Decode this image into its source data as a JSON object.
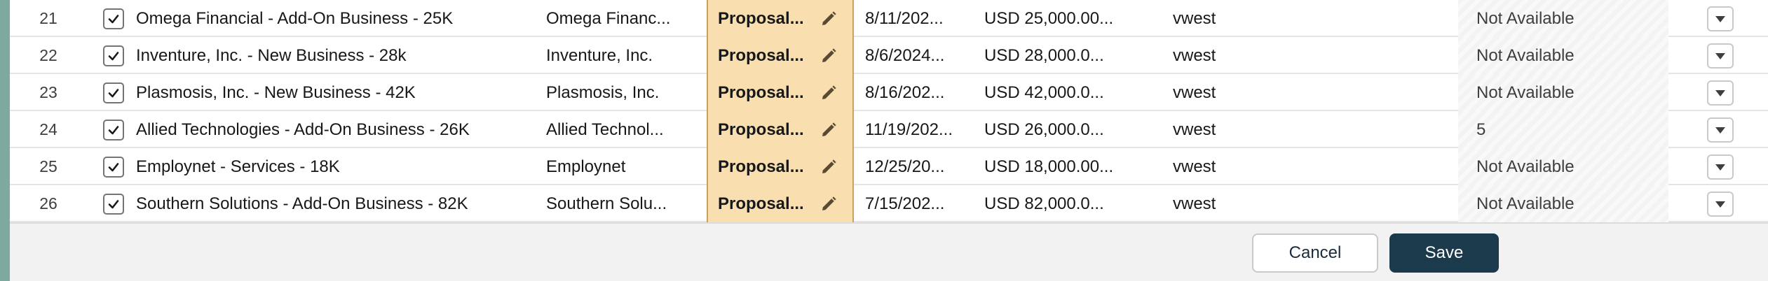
{
  "colors": {
    "stage_bg": "#f9dfb0",
    "save_bg": "#1b3a4b",
    "page_edge": "#7fa8a0"
  },
  "rows": [
    {
      "num": "21",
      "name": "Omega Financial - Add-On Business - 25K",
      "account": "Omega Financ...",
      "stage": "Proposal...",
      "close_date": "8/11/202...",
      "amount": "USD 25,000.00...",
      "owner": "vwest",
      "availability": "Not Available",
      "checked": true
    },
    {
      "num": "22",
      "name": "Inventure, Inc. - New Business - 28k",
      "account": "Inventure, Inc.",
      "stage": "Proposal...",
      "close_date": "8/6/2024...",
      "amount": "USD 28,000.0...",
      "owner": "vwest",
      "availability": "Not Available",
      "checked": true
    },
    {
      "num": "23",
      "name": "Plasmosis, Inc. - New Business - 42K",
      "account": "Plasmosis, Inc.",
      "stage": "Proposal...",
      "close_date": "8/16/202...",
      "amount": "USD 42,000.0...",
      "owner": "vwest",
      "availability": "Not Available",
      "checked": true
    },
    {
      "num": "24",
      "name": "Allied Technologies - Add-On Business - 26K",
      "account": "Allied Technol...",
      "stage": "Proposal...",
      "close_date": "11/19/202...",
      "amount": "USD 26,000.0...",
      "owner": "vwest",
      "availability": "5",
      "checked": true
    },
    {
      "num": "25",
      "name": "Employnet - Services - 18K",
      "account": "Employnet",
      "stage": "Proposal...",
      "close_date": "12/25/20...",
      "amount": "USD 18,000.00...",
      "owner": "vwest",
      "availability": "Not Available",
      "checked": true
    },
    {
      "num": "26",
      "name": "Southern Solutions - Add-On Business - 82K",
      "account": "Southern Solu...",
      "stage": "Proposal...",
      "close_date": "7/15/202...",
      "amount": "USD 82,000.0...",
      "owner": "vwest",
      "availability": "Not Available",
      "checked": true
    }
  ],
  "footer": {
    "cancel_label": "Cancel",
    "save_label": "Save"
  }
}
